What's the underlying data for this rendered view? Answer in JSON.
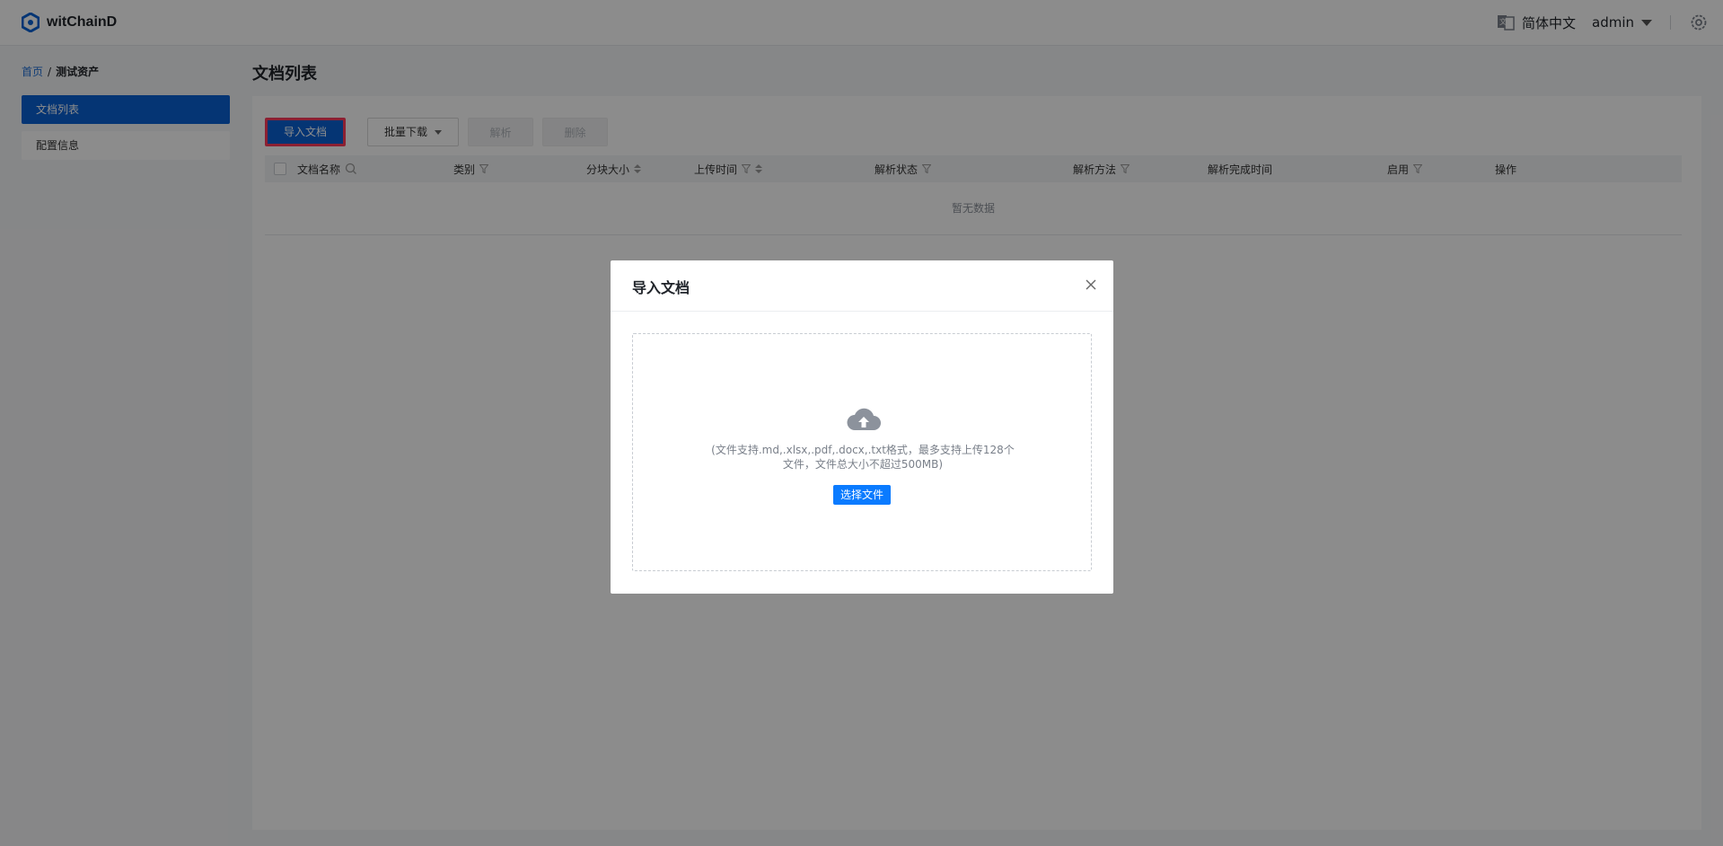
{
  "app": {
    "name": "witChainD"
  },
  "header": {
    "language": "简体中文",
    "user": "admin"
  },
  "breadcrumb": {
    "home": "首页",
    "separator": "/",
    "current": "测试资产"
  },
  "sidebar": {
    "items": [
      {
        "label": "文档列表",
        "active": true
      },
      {
        "label": "配置信息",
        "active": false
      }
    ]
  },
  "page": {
    "title": "文档列表"
  },
  "toolbar": {
    "import": "导入文档",
    "batch_download": "批量下载",
    "parse": "解析",
    "delete": "删除"
  },
  "table": {
    "columns": [
      "文档名称",
      "类别",
      "分块大小",
      "上传时间",
      "解析状态",
      "解析方法",
      "解析完成时间",
      "启用",
      "操作"
    ],
    "empty_text": "暂无数据"
  },
  "modal": {
    "title": "导入文档",
    "hint": "(文件支持.md,.xlsx,.pdf,.docx,.txt格式，最多支持上传128个文件，文件总大小不超过500MB)",
    "choose_button": "选择文件"
  },
  "colors": {
    "primary": "#0a62d4",
    "highlight_border": "#ff3b5c",
    "choose_button": "#0a7bff"
  }
}
